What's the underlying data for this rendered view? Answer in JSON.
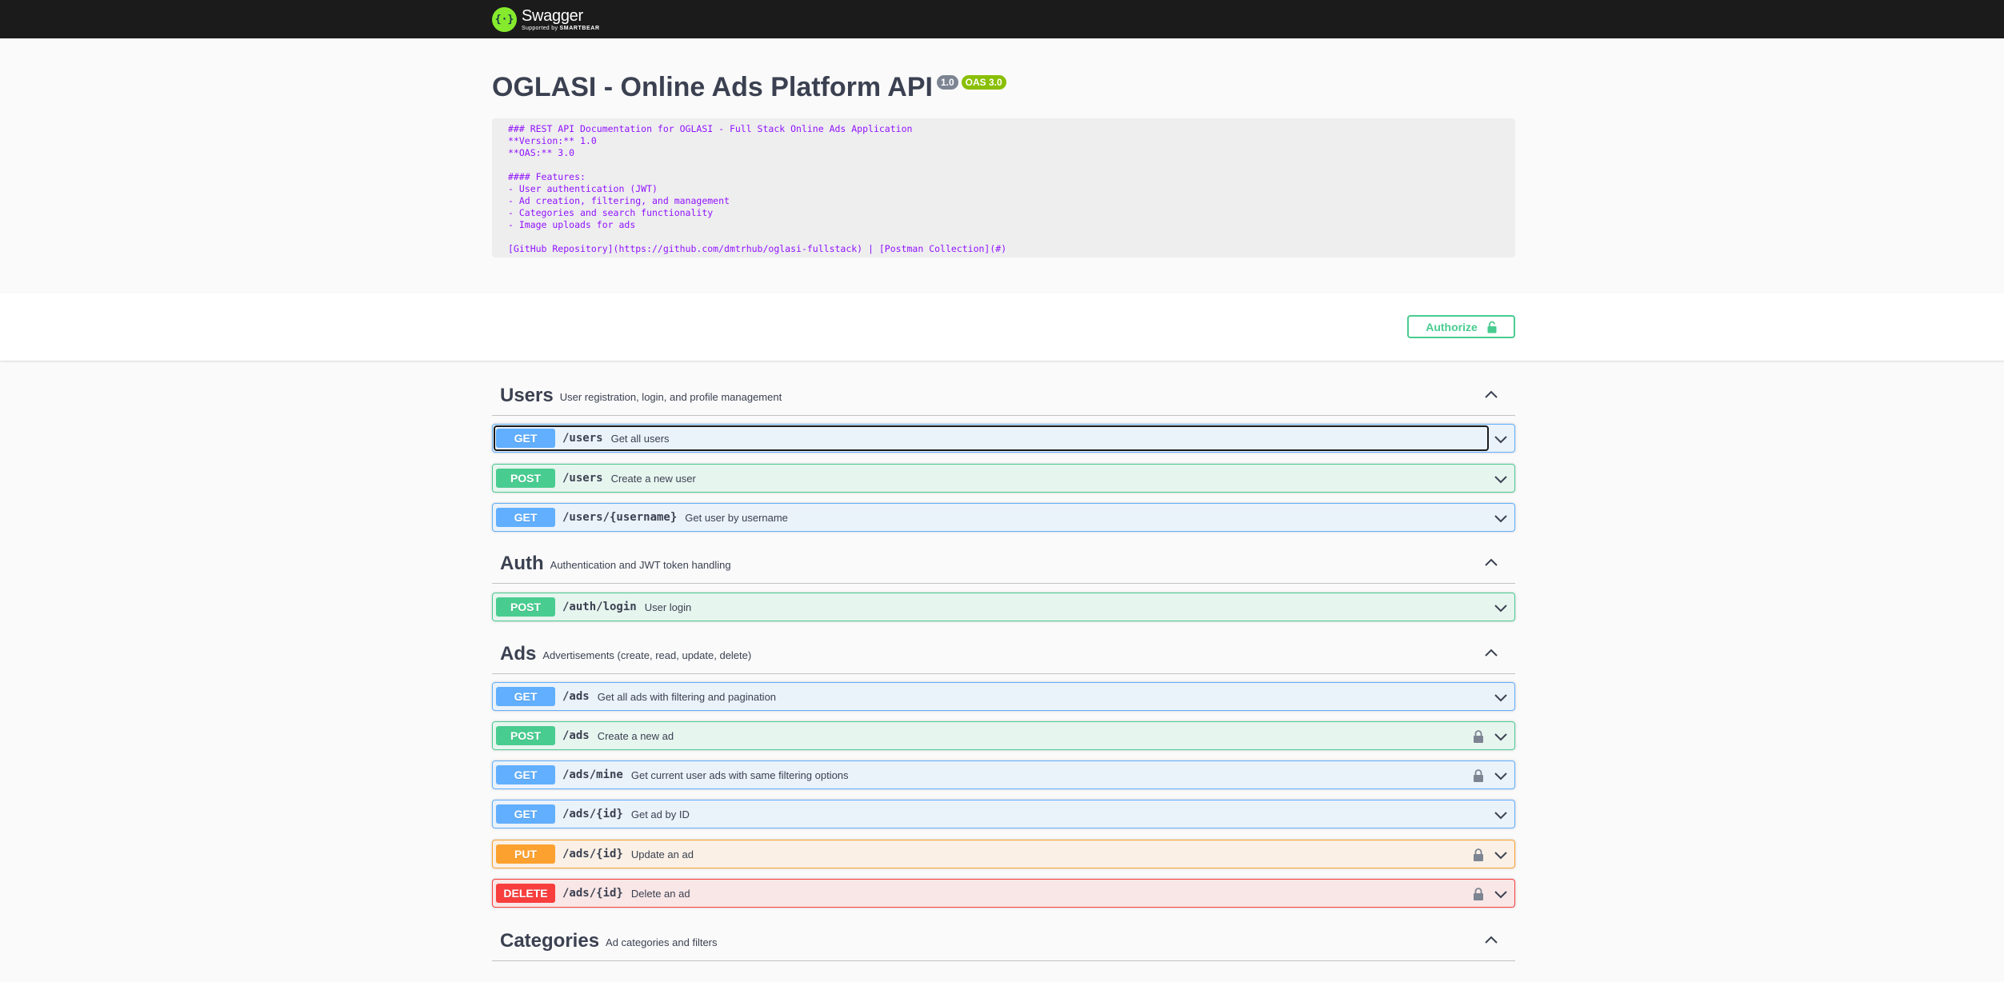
{
  "topbar": {
    "logo_glyph": "{·}",
    "brand_name": "Swagger",
    "brand_sub_prefix": "Supported by ",
    "brand_sub_company": "SMARTBEAR"
  },
  "info": {
    "title": "OGLASI - Online Ads Platform API",
    "version_badge": "1.0",
    "oas_badge": "OAS 3.0",
    "description": "### REST API Documentation for OGLASI - Full Stack Online Ads Application\n**Version:** 1.0\n**OAS:** 3.0\n\n#### Features:\n- User authentication (JWT)\n- Ad creation, filtering, and management\n- Categories and search functionality\n- Image uploads for ads\n\n[GitHub Repository](https://github.com/dmtrhub/oglasi-fullstack) | [Postman Collection](#)"
  },
  "authorize": {
    "label": "Authorize"
  },
  "tags": [
    {
      "name": "Users",
      "description": "User registration, login, and profile management",
      "operations": [
        {
          "method": "GET",
          "path": "/users",
          "summary": "Get all users"
        },
        {
          "method": "POST",
          "path": "/users",
          "summary": "Create a new user"
        },
        {
          "method": "GET",
          "path": "/users/{username}",
          "summary": "Get user by username"
        }
      ]
    },
    {
      "name": "Auth",
      "description": "Authentication and JWT token handling",
      "operations": [
        {
          "method": "POST",
          "path": "/auth/login",
          "summary": "User login"
        }
      ]
    },
    {
      "name": "Ads",
      "description": "Advertisements (create, read, update, delete)",
      "operations": [
        {
          "method": "GET",
          "path": "/ads",
          "summary": "Get all ads with filtering and pagination"
        },
        {
          "method": "POST",
          "path": "/ads",
          "summary": "Create a new ad"
        },
        {
          "method": "GET",
          "path": "/ads/mine",
          "summary": "Get current user ads with same filtering options"
        },
        {
          "method": "GET",
          "path": "/ads/{id}",
          "summary": "Get ad by ID"
        },
        {
          "method": "PUT",
          "path": "/ads/{id}",
          "summary": "Update an ad"
        },
        {
          "method": "DELETE",
          "path": "/ads/{id}",
          "summary": "Delete an ad"
        }
      ]
    },
    {
      "name": "Categories",
      "description": "Ad categories and filters",
      "operations": []
    }
  ],
  "colors": {
    "get": "#61affe",
    "post": "#49cc90",
    "put": "#fca130",
    "delete": "#f93e3e",
    "topbar": "#1b1b1b",
    "logo": "#85ea2d",
    "description_text": "#9012fe"
  },
  "icons": {
    "tag_toggle": "chevron-up-icon",
    "op_toggle": "chevron-down-icon",
    "secured": "lock-icon"
  }
}
